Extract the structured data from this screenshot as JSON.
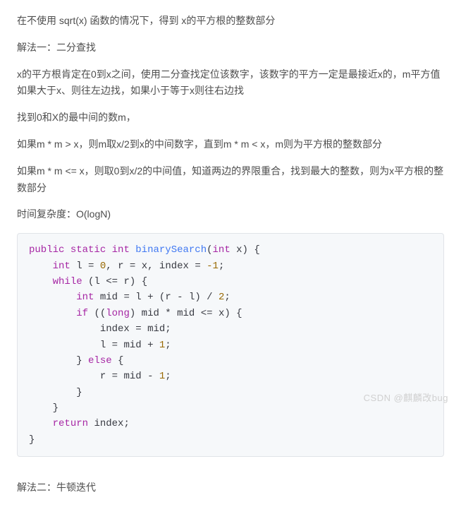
{
  "paragraphs": {
    "p1": "在不使用 sqrt(x) 函数的情况下，得到 x的平方根的整数部分",
    "p2": "解法一：二分查找",
    "p3": "x的平方根肯定在0到x之间，使用二分查找定位该数字，该数字的平方一定是最接近x的，m平方值如果大于x、则往左边找，如果小于等于x则往右边找",
    "p4": "找到0和X的最中间的数m，",
    "p5": "如果m * m > x，则m取x/2到x的中间数字，直到m * m < x，m则为平方根的整数部分",
    "p6": "如果m * m <= x，则取0到x/2的中间值，知道两边的界限重合，找到最大的整数，则为x平方根的整数部分",
    "p7": "时间复杂度：O(logN)",
    "p8": "解法二：牛顿迭代"
  },
  "code": {
    "t_public": "public",
    "t_static": "static",
    "t_int": "int",
    "t_long": "long",
    "t_while": "while",
    "t_if": "if",
    "t_else": "else",
    "t_return": "return",
    "fn_name": "binarySearch",
    "param_x": "x",
    "var_l": "l",
    "var_r": "r",
    "var_index": "index",
    "var_mid": "mid",
    "n0": "0",
    "n1": "1",
    "n2": "2",
    "nneg1": "-1"
  },
  "watermark": "CSDN @麒麟改bug"
}
